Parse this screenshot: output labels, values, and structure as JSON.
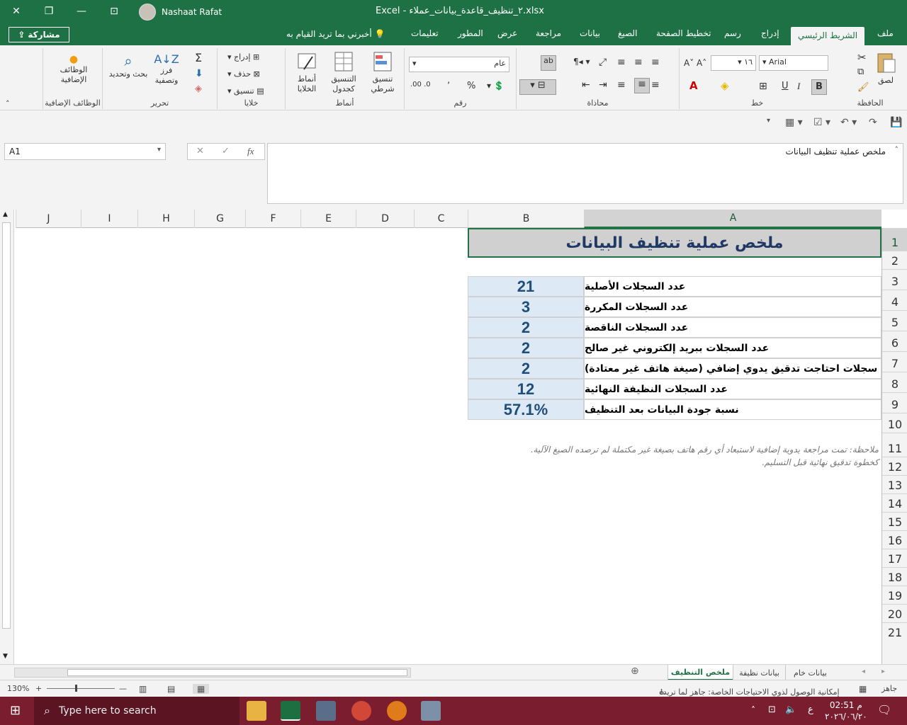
{
  "window": {
    "app_name": "Excel",
    "file_name": "٢_تنظيف_قاعدة_بيانات_عملاء.xlsx",
    "user_name": "Nashaat Rafat"
  },
  "ribbon_tabs": [
    "ملف",
    "الشريط الرئيسي",
    "إدراج",
    "رسم",
    "تخطيط الصفحة",
    "الصيغ",
    "بيانات",
    "مراجعة",
    "عرض",
    "المطور",
    "تعليمات"
  ],
  "tell_me": "أخبرني بما تريد القيام به",
  "share_label": "مشاركة",
  "ribbon": {
    "clipboard": {
      "label": "الحافظة",
      "paste": "لصق"
    },
    "font": {
      "label": "خط",
      "name": "Arial",
      "size": "١٦"
    },
    "alignment": {
      "label": "محاذاة"
    },
    "number": {
      "label": "رقم",
      "format": "عام"
    },
    "styles": {
      "label": "أنماط",
      "conditional": "تنسيق شرطي",
      "table": "التنسيق كجدول",
      "cell": "أنماط الخلايا"
    },
    "cells": {
      "label": "خلايا",
      "insert": "إدراج",
      "delete": "حذف",
      "format": "تنسيق"
    },
    "editing": {
      "label": "تحرير",
      "sort": "فرز وتصفية",
      "find": "بحث وتحديد"
    },
    "addins": {
      "label": "الوظائف الإضافية",
      "button": "الوظائف الإضافية"
    }
  },
  "formula_bar": {
    "name_box": "A1",
    "content": "ملخص عملية تنظيف البيانات"
  },
  "columns": [
    "J",
    "I",
    "H",
    "G",
    "F",
    "E",
    "D",
    "C",
    "B",
    "A"
  ],
  "rows": [
    "1",
    "2",
    "3",
    "4",
    "5",
    "6",
    "7",
    "8",
    "9",
    "10",
    "11",
    "12",
    "13",
    "14",
    "15",
    "16",
    "17",
    "18",
    "19",
    "20",
    "21"
  ],
  "sheet": {
    "title": "ملخص عملية تنظيف البيانات",
    "summary": [
      {
        "label": "عدد السجلات الأصلية",
        "value": "21"
      },
      {
        "label": "عدد السجلات المكررة",
        "value": "3"
      },
      {
        "label": "عدد السجلات الناقصة",
        "value": "2"
      },
      {
        "label": "عدد السجلات ببريد إلكتروني غير صالح",
        "value": "2"
      },
      {
        "label": "سجلات احتاجت تدقيق يدوي إضافي (صيغة هاتف غير معتادة)",
        "value": "2"
      },
      {
        "label": "عدد السجلات النظيفة النهائية",
        "value": "12"
      },
      {
        "label": "نسبة جودة البيانات بعد التنظيف",
        "value": "57.1%"
      }
    ],
    "note_line1": "ملاحظة: تمت مراجعة يدوية إضافية لاستبعاد أي رقم هاتف بصيغة غير مكتملة لم ترصده الصيغ الآلية.",
    "note_line2": "كخطوة تدقيق نهائية قبل التسليم."
  },
  "sheet_tabs": [
    {
      "name": "ملخص التنظيف",
      "active": true
    },
    {
      "name": "بيانات نظيفة",
      "active": false
    },
    {
      "name": "بيانات خام",
      "active": false
    }
  ],
  "status_bar": {
    "ready": "جاهز",
    "accessibility": "إمكانية الوصول لذوي الاحتياجات الخاصة: جاهز لما تريده",
    "zoom": "130%"
  },
  "taskbar": {
    "search_placeholder": "Type here to search",
    "time": "02:51 م",
    "date": "٢٠٢٦/٠٦/٢٠",
    "lang": "ع"
  }
}
